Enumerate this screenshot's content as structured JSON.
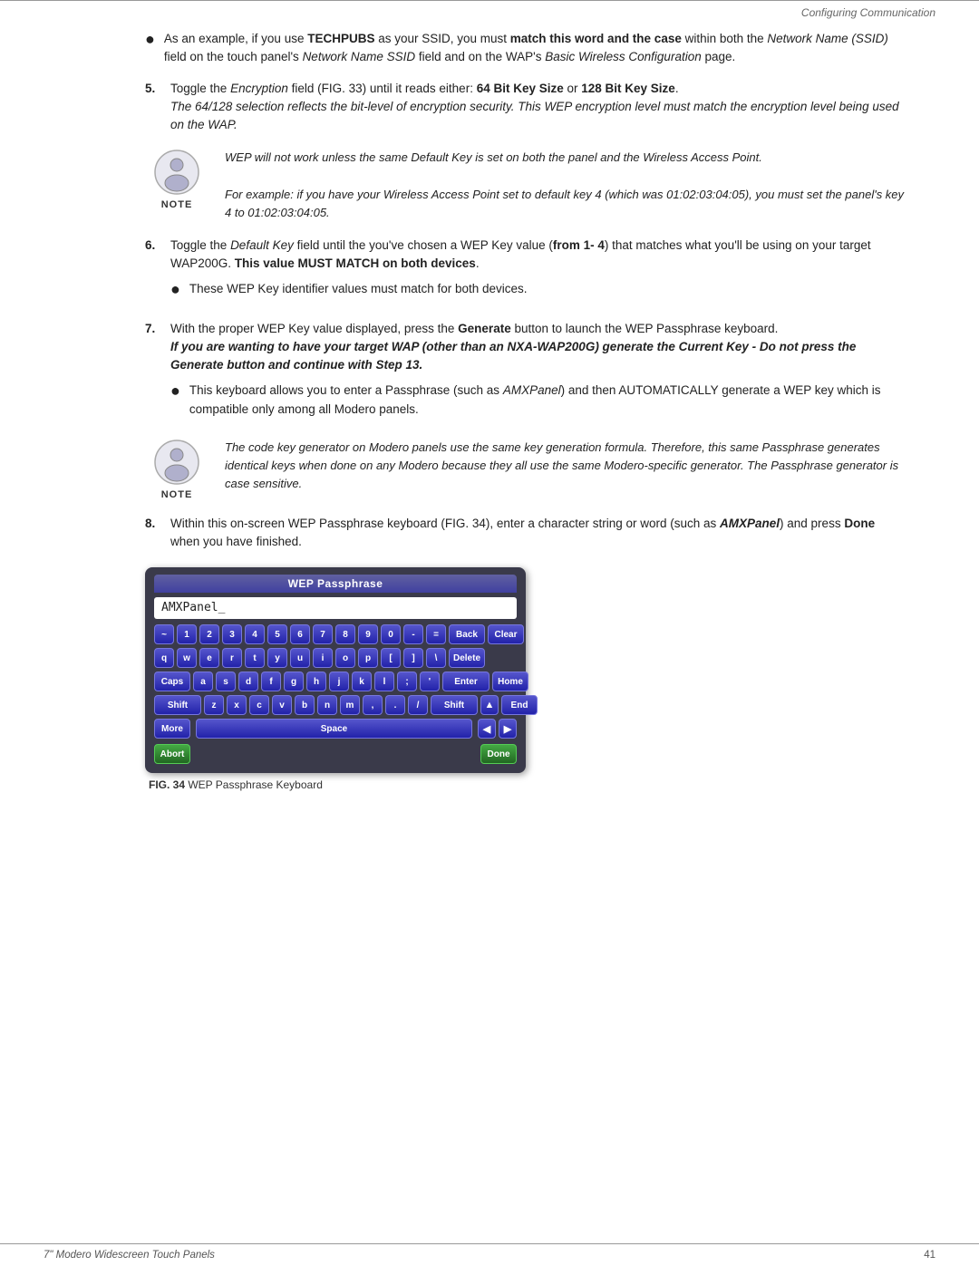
{
  "header": {
    "title": "Configuring Communication"
  },
  "bullet1": {
    "text_prefix": "As an example, if you use ",
    "bold1": "TECHPUBS",
    "text_mid1": " as your SSID, you must ",
    "bold2": "match this word and the case",
    "text_mid2": " within both the ",
    "italic1": "Network Name (SSID)",
    "text_mid3": " field on the touch panel's ",
    "italic2": "Network Name SSID",
    "text_mid4": " field and on the WAP's ",
    "italic3": "Basic Wireless Configuration",
    "text_end": " page."
  },
  "step5": {
    "num": "5.",
    "text_prefix": "Toggle the ",
    "italic1": "Encryption",
    "text_mid1": " field (FIG. 33) until it reads either: ",
    "bold1": "64 Bit Key Size",
    "text_mid2": " or ",
    "bold2": "128 Bit Key Size",
    "text_end": ".",
    "italic_line": "The 64/128 selection reflects the bit-level of encryption security. This WEP encryption level must match the encryption level being used on the WAP."
  },
  "note1": {
    "label": "NOTE",
    "lines": [
      "WEP will not work unless the same Default Key is set on both the panel and the Wireless Access Point.",
      "For example: if you have your Wireless Access Point set to default key 4 (which was 01:02:03:04:05), you must set the panel's key 4 to 01:02:03:04:05."
    ]
  },
  "step6": {
    "num": "6.",
    "text_prefix": "Toggle the ",
    "italic1": "Default Key",
    "text_mid1": " field until the you've chosen a WEP Key value (",
    "bold1": "from 1- 4",
    "text_mid2": ") that matches what you'll be using on your target WAP200G. ",
    "bold2": "This value MUST MATCH on both devices",
    "text_end": ".",
    "sub_bullet": "These WEP Key identifier values must match for both devices."
  },
  "step7": {
    "num": "7.",
    "text_prefix": "With the proper WEP Key value displayed, press the ",
    "bold1": "Generate",
    "text_end": " button to launch the WEP Passphrase keyboard.",
    "bold_italic": "If you are wanting to have your target WAP (other than an NXA-WAP200G) generate the Current Key - Do not press the Generate button and continue with Step 13.",
    "sub_bullet": "This keyboard allows you to enter a Passphrase (such as ",
    "sub_italic": "AMXPanel",
    "sub_end": ") and then AUTOMATICALLY generate a WEP key which is compatible only among all Modero panels."
  },
  "note2": {
    "label": "NOTE",
    "lines": [
      "The code key generator on Modero panels use the same key generation formula. Therefore, this same Passphrase generates identical keys when done on any Modero because they all use the same Modero-specific generator. The Passphrase generator is case sensitive."
    ]
  },
  "step8": {
    "num": "8.",
    "text_prefix": "Within this on-screen WEP Passphrase keyboard (FIG. 34), enter a character string or word (such as ",
    "bold_italic": "AMXPanel",
    "text_mid": ") and press ",
    "bold1": "Done",
    "text_end": " when you have finished."
  },
  "keyboard": {
    "title": "WEP Passphrase",
    "input_value": "AMXPanel_",
    "rows": [
      {
        "keys": [
          {
            "label": "~",
            "type": "normal"
          },
          {
            "label": "1",
            "type": "normal"
          },
          {
            "label": "2",
            "type": "normal"
          },
          {
            "label": "3",
            "type": "normal"
          },
          {
            "label": "4",
            "type": "normal"
          },
          {
            "label": "5",
            "type": "normal"
          },
          {
            "label": "6",
            "type": "normal"
          },
          {
            "label": "7",
            "type": "normal"
          },
          {
            "label": "8",
            "type": "normal"
          },
          {
            "label": "9",
            "type": "normal"
          },
          {
            "label": "0",
            "type": "normal"
          },
          {
            "label": "-",
            "type": "normal"
          },
          {
            "label": "=",
            "type": "normal"
          },
          {
            "label": "Back",
            "type": "wide"
          },
          {
            "label": "Clear",
            "type": "wide"
          }
        ]
      },
      {
        "keys": [
          {
            "label": "q",
            "type": "normal"
          },
          {
            "label": "w",
            "type": "normal"
          },
          {
            "label": "e",
            "type": "normal"
          },
          {
            "label": "r",
            "type": "normal"
          },
          {
            "label": "t",
            "type": "normal"
          },
          {
            "label": "y",
            "type": "normal"
          },
          {
            "label": "u",
            "type": "normal"
          },
          {
            "label": "i",
            "type": "normal"
          },
          {
            "label": "o",
            "type": "normal"
          },
          {
            "label": "p",
            "type": "normal"
          },
          {
            "label": "[",
            "type": "normal"
          },
          {
            "label": "]",
            "type": "normal"
          },
          {
            "label": "\\",
            "type": "normal"
          },
          {
            "label": "Delete",
            "type": "wide"
          }
        ]
      },
      {
        "keys": [
          {
            "label": "Caps",
            "type": "wide"
          },
          {
            "label": "a",
            "type": "normal"
          },
          {
            "label": "s",
            "type": "normal"
          },
          {
            "label": "d",
            "type": "normal"
          },
          {
            "label": "f",
            "type": "normal"
          },
          {
            "label": "g",
            "type": "normal"
          },
          {
            "label": "h",
            "type": "normal"
          },
          {
            "label": "j",
            "type": "normal"
          },
          {
            "label": "k",
            "type": "normal"
          },
          {
            "label": "l",
            "type": "normal"
          },
          {
            "label": ";",
            "type": "normal"
          },
          {
            "label": "'",
            "type": "normal"
          },
          {
            "label": "Enter",
            "type": "wider"
          },
          {
            "label": "Home",
            "type": "wide"
          }
        ]
      },
      {
        "keys": [
          {
            "label": "Shift",
            "type": "wider"
          },
          {
            "label": "z",
            "type": "normal"
          },
          {
            "label": "x",
            "type": "normal"
          },
          {
            "label": "c",
            "type": "normal"
          },
          {
            "label": "v",
            "type": "normal"
          },
          {
            "label": "b",
            "type": "normal"
          },
          {
            "label": "n",
            "type": "normal"
          },
          {
            "label": "m",
            "type": "normal"
          },
          {
            "label": ",",
            "type": "normal"
          },
          {
            "label": ".",
            "type": "normal"
          },
          {
            "label": "/",
            "type": "normal"
          },
          {
            "label": "Shift",
            "type": "wider"
          },
          {
            "label": "▲",
            "type": "arrow"
          },
          {
            "label": "End",
            "type": "wide"
          }
        ]
      },
      {
        "keys": [
          {
            "label": "More",
            "type": "wide",
            "color": "blue"
          },
          {
            "label": "Space",
            "type": "space"
          },
          {
            "label": "◀",
            "type": "arrow"
          },
          {
            "label": "▶",
            "type": "arrow"
          }
        ]
      }
    ],
    "abort_label": "Abort",
    "done_label": "Done"
  },
  "figure_caption": {
    "bold": "FIG. 34",
    "text": "  WEP Passphrase Keyboard"
  },
  "footer": {
    "left": "7\" Modero Widescreen Touch Panels",
    "right": "41"
  }
}
